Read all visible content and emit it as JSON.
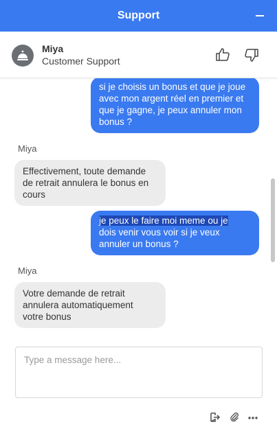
{
  "header": {
    "title": "Support",
    "minimize_icon": "minimize-icon"
  },
  "agent": {
    "name": "Miya",
    "role": "Customer Support",
    "avatar_icon": "concierge-bell-icon",
    "rate_up_icon": "thumbs-up-icon",
    "rate_down_icon": "thumbs-down-icon"
  },
  "messages": [
    {
      "from": "user",
      "lines": [
        "si je choisis un bonus et que je joue",
        "avec mon argent réel en premier et",
        "que je gagne, je peux annuler mon",
        "bonus ?"
      ]
    },
    {
      "from": "agent",
      "sender": "Miya",
      "lines": [
        "Effectivement, toute demande",
        "de retrait annulera le bonus en",
        "cours"
      ]
    },
    {
      "from": "user",
      "lines": [
        "je peux le faire moi meme ou je",
        "dois venir vous voir si je veux",
        "annuler un bonus ?"
      ]
    },
    {
      "from": "agent",
      "sender": "Miya",
      "lines": [
        "Votre demande de retrait",
        "annulera automatiquement",
        "votre bonus"
      ]
    }
  ],
  "composer": {
    "placeholder": "Type a message here..."
  },
  "footer_icons": [
    "exit-icon",
    "paperclip-icon",
    "more-icon"
  ],
  "colors": {
    "accent": "#3a7af0",
    "agent_bubble": "#ececec",
    "highlight": "#1d48b5"
  }
}
